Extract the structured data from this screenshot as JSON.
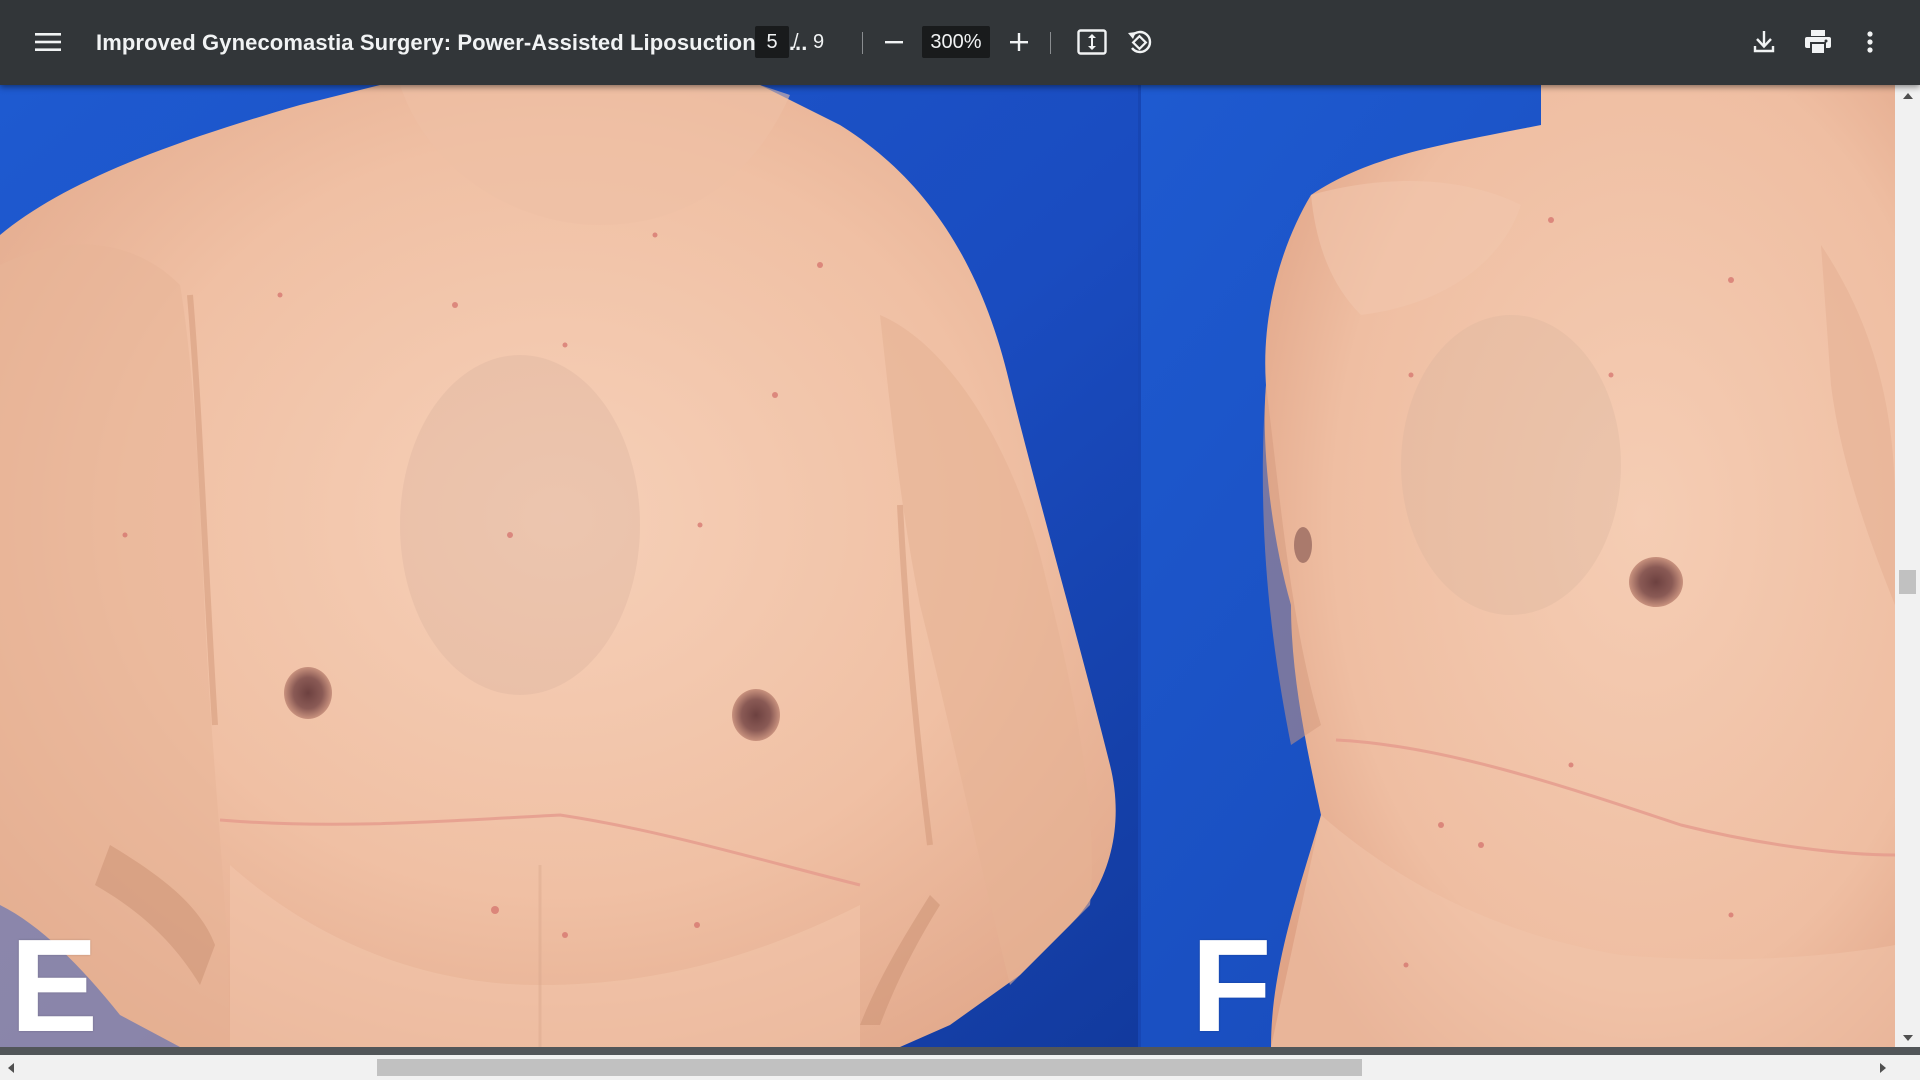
{
  "toolbar": {
    "menu_icon": "hamburger-menu-icon",
    "title": "Improved Gynecomastia Surgery: Power-Assisted Liposuction Wi...",
    "current_page": "5",
    "page_separator": "/",
    "total_pages": "9",
    "zoom_out_icon": "minus-icon",
    "zoom_level": "300%",
    "zoom_in_icon": "plus-icon",
    "fit_page_icon": "fit-to-page-icon",
    "rotate_icon": "rotate-counterclockwise-icon",
    "download_icon": "download-icon",
    "print_icon": "print-icon",
    "more_icon": "more-vertical-icon"
  },
  "document": {
    "panels": [
      {
        "label": "E"
      },
      {
        "label": "F"
      }
    ]
  },
  "colors": {
    "toolbar_bg": "#323639",
    "photo_background_blue": "#1d4fc4",
    "skin_tone": "#f0c3a8"
  }
}
